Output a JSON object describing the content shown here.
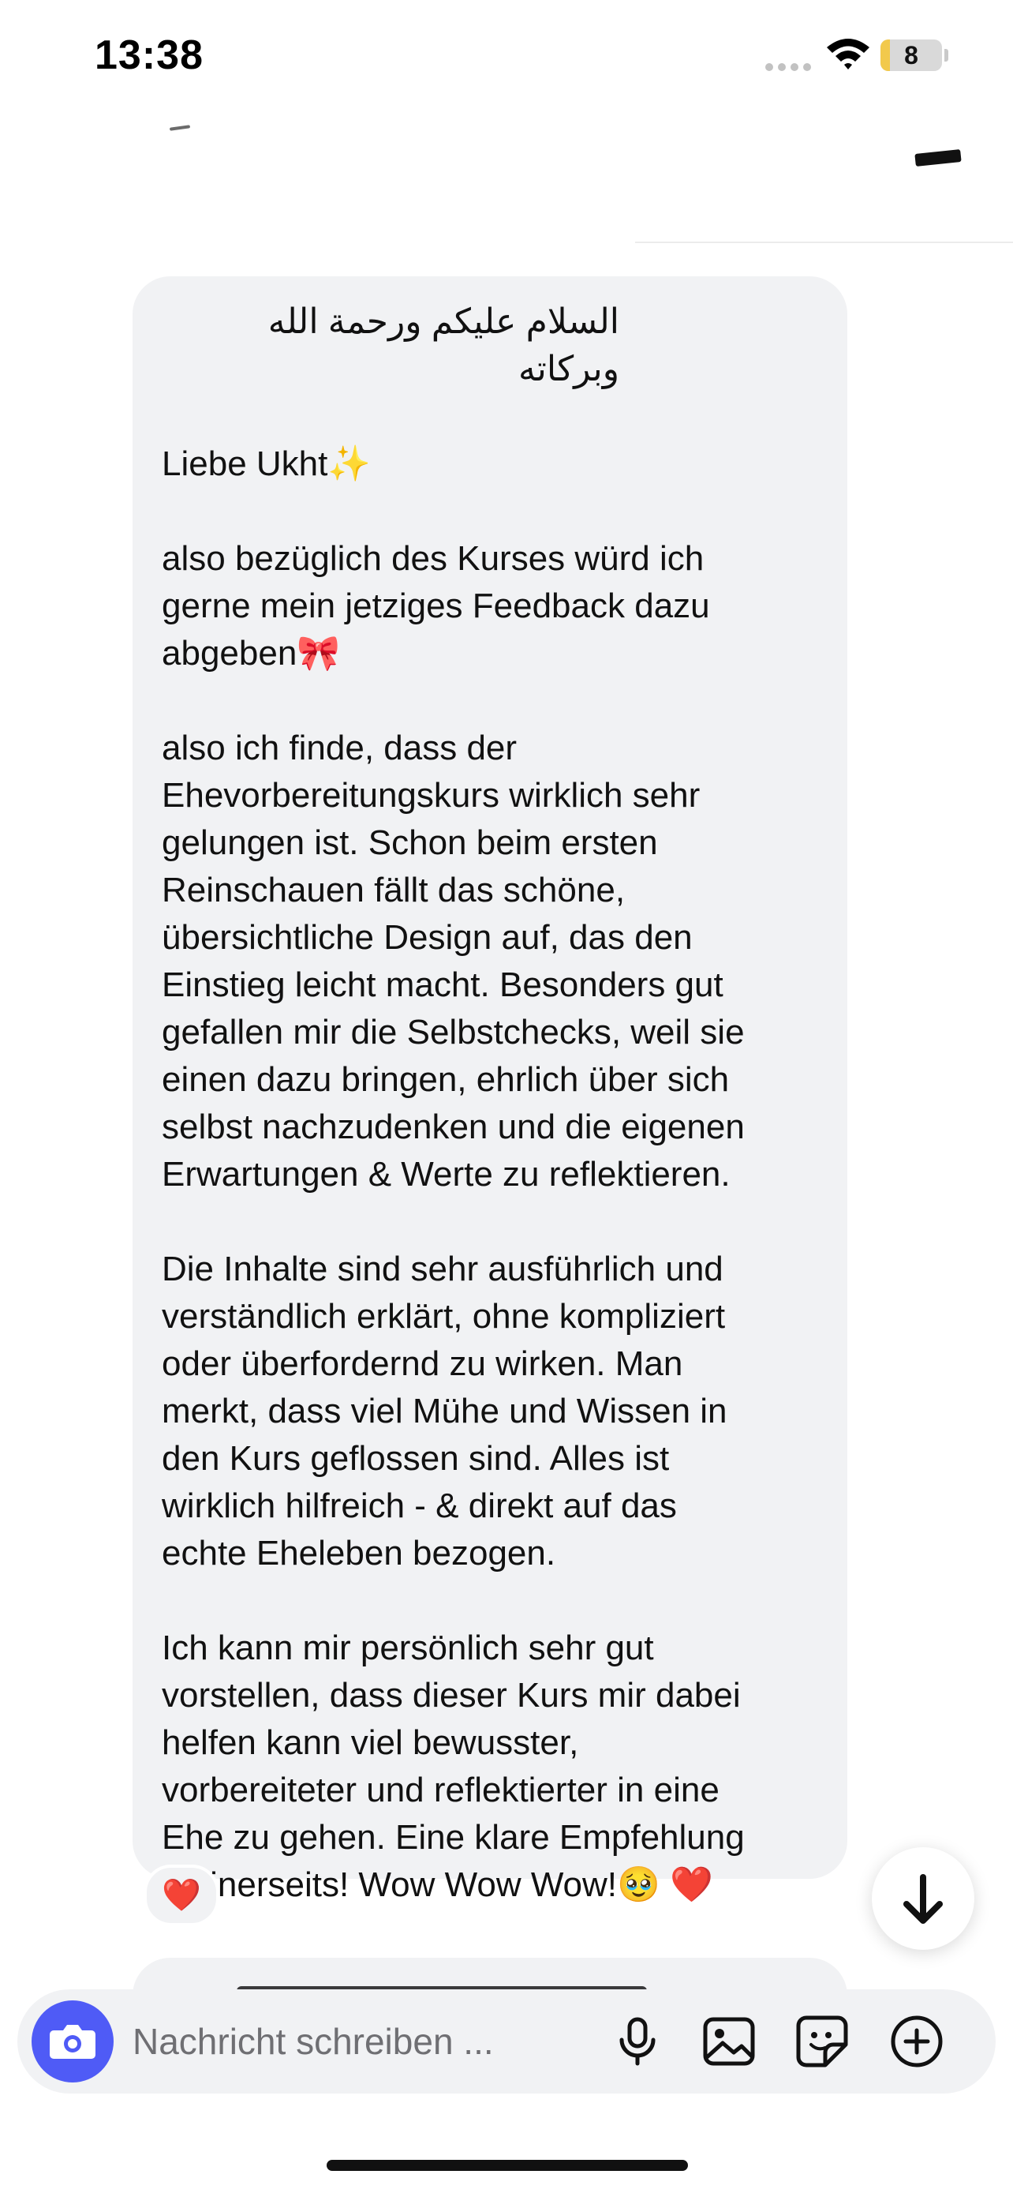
{
  "status_bar": {
    "time": "13:38",
    "battery_level": "8",
    "battery_fraction": 0.15
  },
  "message": {
    "arabic_greeting": "السلام عليكم ورحمة الله وبركاته",
    "paragraphs": [
      "Liebe Ukht✨",
      "also bezüglich des Kurses würd ich\ngerne mein jetziges Feedback dazu\nabgeben🎀",
      "also ich finde, dass der\nEhevorbereitungskurs wirklich sehr\ngelungen ist. Schon beim ersten\nReinschauen fällt das schöne,\nübersichtliche Design auf, das den\nEinstieg leicht macht. Besonders gut\ngefallen mir die Selbstchecks, weil sie\neinen dazu bringen, ehrlich über sich\nselbst nachzudenken und die eigenen\nErwartungen & Werte zu reflektieren.",
      "Die Inhalte sind sehr ausführlich und\nverständlich erklärt, ohne kompliziert\noder überfordernd zu wirken. Man\nmerkt, dass viel Mühe und Wissen in\nden Kurs geflossen sind. Alles ist\nwirklich hilfreich - & direkt auf das\nechte Eheleben bezogen.",
      "Ich kann mir persönlich sehr gut\nvorstellen, dass dieser Kurs mir dabei\nhelfen kann viel bewusster,\nvorbereiteter und reflektierter in eine\nEhe zu gehen. Eine klare Empfehlung\nmeinerseits! Wow Wow Wow!🥹 ❤️"
    ],
    "reaction": "❤️"
  },
  "composer": {
    "placeholder": "Nachricht schreiben ...",
    "value": ""
  },
  "icons": {
    "camera": "camera-icon",
    "microphone": "microphone-icon",
    "gallery": "image-icon",
    "sticker": "sticker-icon",
    "add": "plus-circle-icon",
    "scroll_down": "arrow-down-icon"
  },
  "colors": {
    "accent": "#4f5bf6",
    "bubble": "#f1f2f4",
    "reaction_heart": "#e0245e",
    "battery_fill": "#f2c94c"
  }
}
